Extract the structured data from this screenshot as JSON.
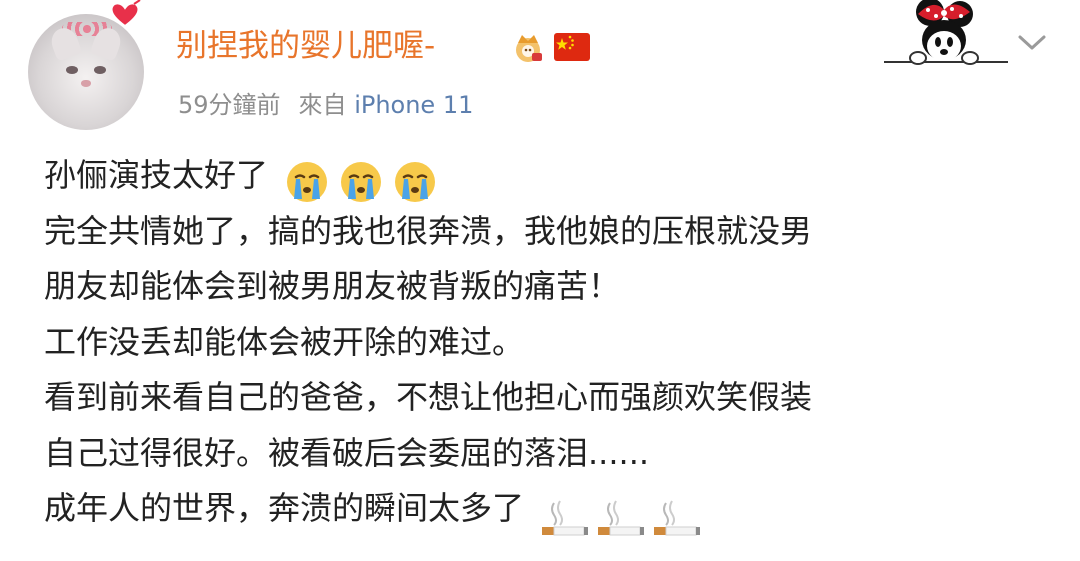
{
  "author": {
    "name": "别捏我的婴儿肥喔-",
    "avatar_icon": "white-cat-avatar",
    "badges": [
      "crown-vip-badge",
      "china-flag-badge"
    ],
    "name_color": "#e8752b"
  },
  "meta": {
    "time": "59分鐘前",
    "source": "來自",
    "device": "iPhone 11"
  },
  "header_icons": {
    "decoration": "minnie-mouse-peeking-icon",
    "menu": "chevron-down-icon"
  },
  "post": {
    "lines": [
      "孙俪演技太好了",
      "完全共情她了，搞的我也很奔溃，我他娘的压根就没男",
      "朋友却能体会到被男朋友被背叛的痛苦！",
      "工作没丢却能体会被开除的难过。",
      "看到前来看自己的爸爸，不想让他担心而强颜欢笑假装",
      "自己过得很好。被看破后会委屈的落泪......",
      "成年人的世界，奔溃的瞬间太多了"
    ],
    "line1_emojis": [
      "crying-face-emoji",
      "crying-face-emoji",
      "crying-face-emoji"
    ],
    "line7_emojis": [
      "cigarette-emoji",
      "cigarette-emoji",
      "cigarette-emoji"
    ]
  }
}
